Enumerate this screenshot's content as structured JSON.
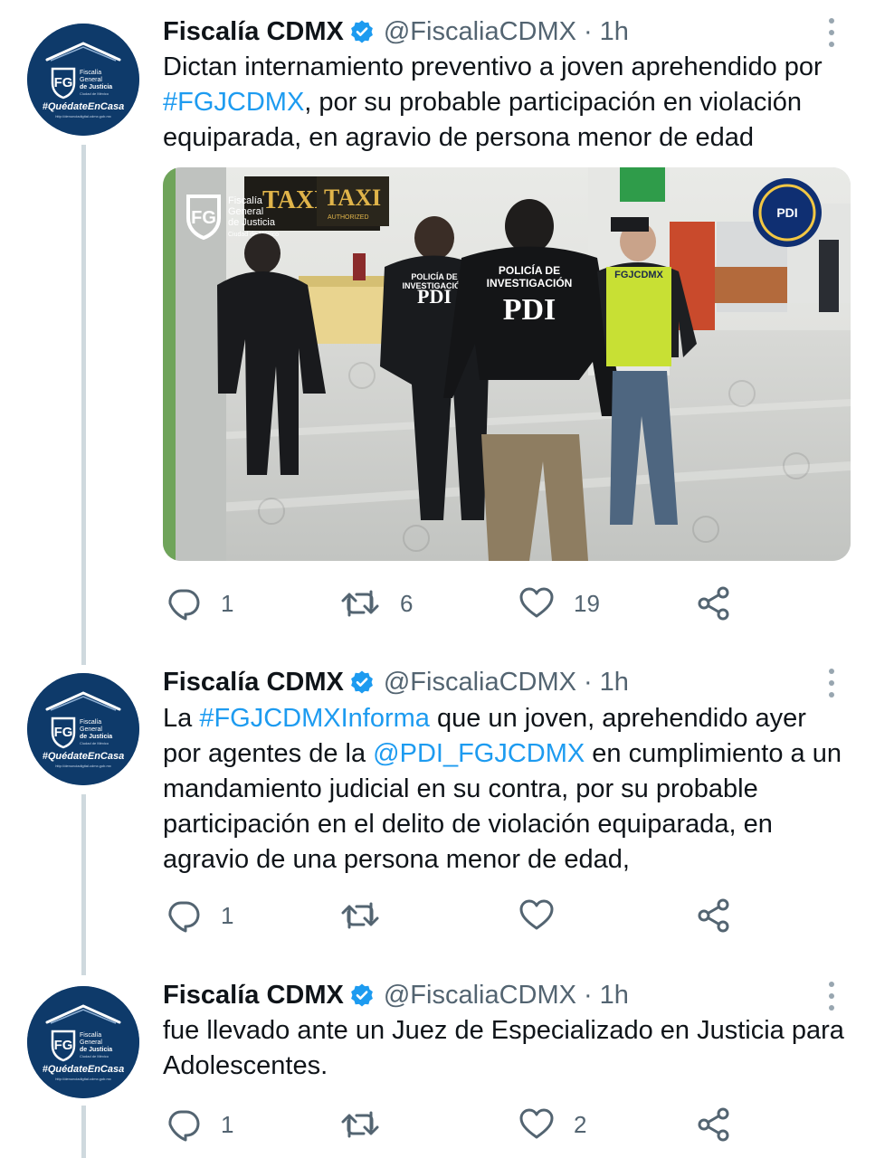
{
  "colors": {
    "link": "#1d9bf0",
    "secondary_text": "#536471",
    "verified_badge": "#1d9bf0",
    "avatar_background": "#0e3a6a",
    "thread_line": "#cfd9de"
  },
  "avatar": {
    "org_line1": "Fiscalía",
    "org_line2": "General",
    "org_line3": "de Justicia",
    "org_line4": "Ciudad de México",
    "hashtag": "#QuédateEnCasa",
    "url": "http://denunciadigital.cdmx.gob.mx"
  },
  "tweets": [
    {
      "author_name": "Fiscalía CDMX",
      "handle": "@FiscaliaCDMX",
      "separator": "·",
      "time": "1h",
      "text_parts": [
        {
          "text": "Dictan internamiento preventivo a joven aprehendido por "
        },
        {
          "text": "#FGJCDMX",
          "link": true
        },
        {
          "text": ", por su probable participación en violación equiparada, en agravio de persona menor de edad"
        }
      ],
      "media": {
        "logo_text_line1": "Fiscalía",
        "logo_text_line2": "General",
        "logo_text_line3": "de Justicia",
        "logo_text_line4": "Ciudad de México",
        "sign_taxi_1": "TAXI",
        "sign_taxi_2": "TAXI",
        "sign_taxi_sub": "AUTHORIZED",
        "badge_text": "PDI",
        "officer_center_line1": "POLICÍA DE",
        "officer_center_line2": "INVESTIGACIÓN",
        "officer_center_line3": "PDI",
        "officer_left_line1": "POLICÍA DE",
        "officer_left_line2": "INVESTIGACIÓN",
        "officer_left_line3": "PDI",
        "vest_text": "FGJCDMX"
      },
      "replies": "1",
      "retweets": "6",
      "likes": "19"
    },
    {
      "author_name": "Fiscalía CDMX",
      "handle": "@FiscaliaCDMX",
      "separator": "·",
      "time": "1h",
      "text_parts": [
        {
          "text": "La "
        },
        {
          "text": "#FGJCDMXInforma",
          "link": true
        },
        {
          "text": " que un joven, aprehendido ayer por agentes de la "
        },
        {
          "text": "@PDI_FGJCDMX",
          "link": true
        },
        {
          "text": " en cumplimiento a un mandamiento judicial en su contra, por su probable participación en el delito de violación equiparada, en agravio de una persona menor de edad,"
        }
      ],
      "replies": "1",
      "retweets": "",
      "likes": ""
    },
    {
      "author_name": "Fiscalía CDMX",
      "handle": "@FiscaliaCDMX",
      "separator": "·",
      "time": "1h",
      "text_parts": [
        {
          "text": "fue llevado ante un Juez de Especializado en Justicia para Adolescentes."
        }
      ],
      "replies": "1",
      "retweets": "",
      "likes": "2"
    }
  ]
}
